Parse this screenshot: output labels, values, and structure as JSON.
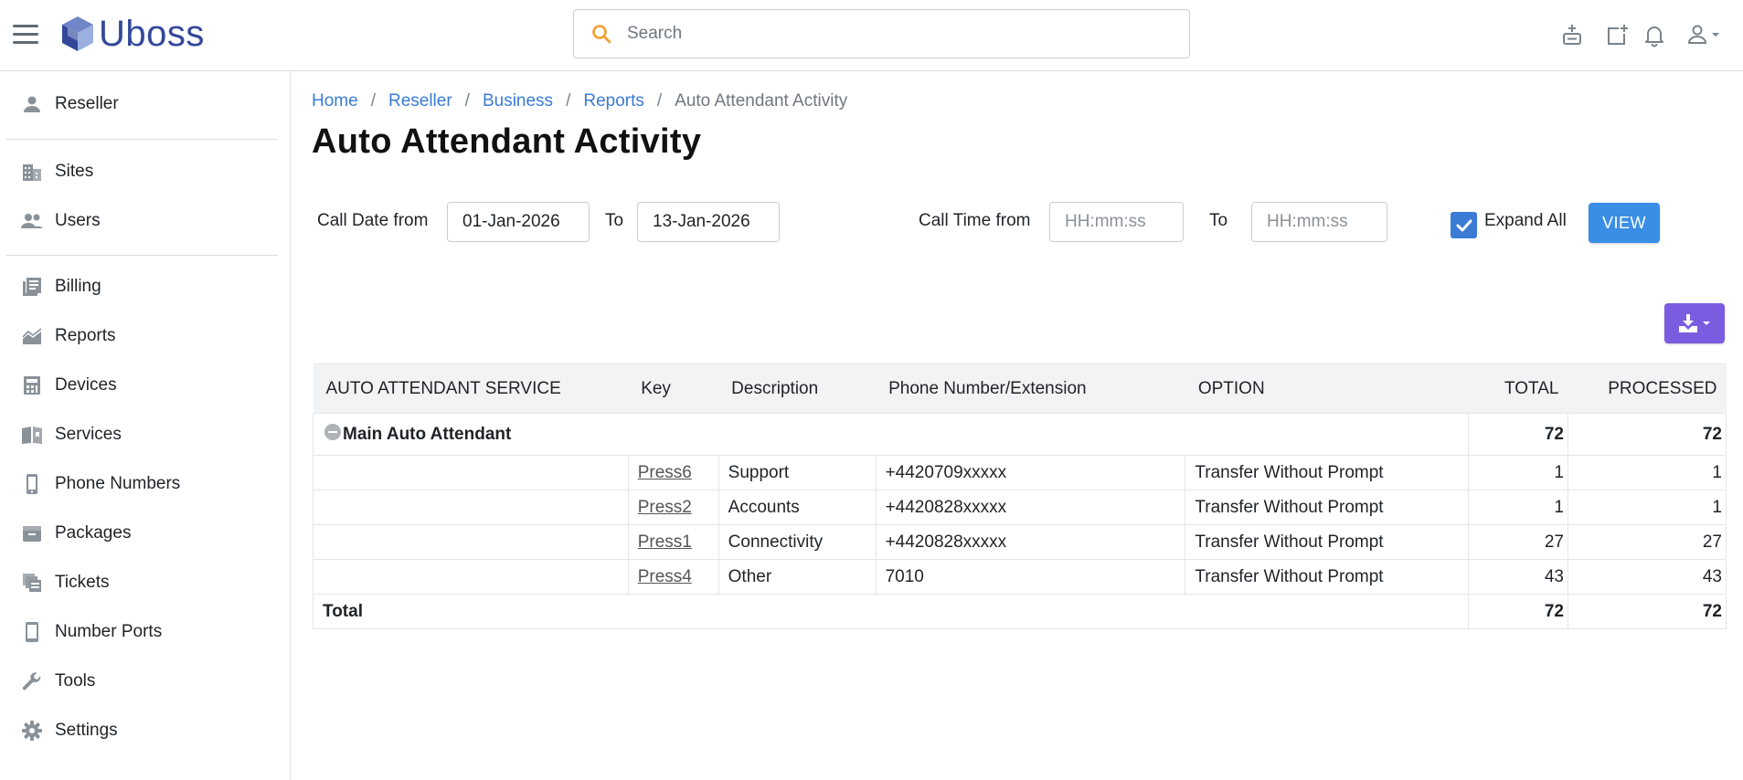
{
  "app": {
    "name": "Uboss"
  },
  "header": {
    "search_placeholder": "Search",
    "icons": [
      "add-contact-icon",
      "new-window-icon",
      "bell-icon",
      "user-icon"
    ]
  },
  "sidebar": {
    "items": [
      {
        "label": "Reseller",
        "icon": "person-icon"
      },
      {
        "label": "Sites",
        "icon": "building-icon"
      },
      {
        "label": "Users",
        "icon": "users-icon"
      },
      {
        "label": "Billing",
        "icon": "billing-icon"
      },
      {
        "label": "Reports",
        "icon": "chart-icon"
      },
      {
        "label": "Devices",
        "icon": "devices-icon"
      },
      {
        "label": "Services",
        "icon": "services-icon"
      },
      {
        "label": "Phone Numbers",
        "icon": "phone-icon"
      },
      {
        "label": "Packages",
        "icon": "package-icon"
      },
      {
        "label": "Tickets",
        "icon": "tickets-icon"
      },
      {
        "label": "Number Ports",
        "icon": "mobile-icon"
      },
      {
        "label": "Tools",
        "icon": "wrench-icon"
      },
      {
        "label": "Settings",
        "icon": "gear-icon"
      }
    ]
  },
  "breadcrumb": {
    "items": [
      "Home",
      "Reseller",
      "Business",
      "Reports"
    ],
    "current": "Auto Attendant Activity",
    "separator": "/"
  },
  "page": {
    "title": "Auto Attendant Activity"
  },
  "filters": {
    "call_date_from_label": "Call Date from",
    "call_date_from": "01-Jan-2026",
    "to_label": "To",
    "call_date_to": "13-Jan-2026",
    "call_time_from_label": "Call Time from",
    "call_time_from_placeholder": "HH:mm:ss",
    "call_time_to_label": "To",
    "call_time_to_placeholder": "HH:mm:ss",
    "expand_all_label": "Expand All",
    "expand_all_checked": true,
    "view_label": "VIEW"
  },
  "table": {
    "headers": [
      "AUTO ATTENDANT SERVICE",
      "Key",
      "Description",
      "Phone Number/Extension",
      "OPTION",
      "TOTAL",
      "PROCESSED"
    ],
    "group": {
      "name": "Main Auto Attendant",
      "total": "72",
      "processed": "72"
    },
    "rows": [
      {
        "key": "Press6",
        "description": "Support",
        "phone": "+4420709xxxxx",
        "option": "Transfer Without Prompt",
        "total": "1",
        "processed": "1"
      },
      {
        "key": "Press2",
        "description": "Accounts",
        "phone": "+4420828xxxxx",
        "option": "Transfer Without Prompt",
        "total": "1",
        "processed": "1"
      },
      {
        "key": "Press1",
        "description": "Connectivity",
        "phone": "+4420828xxxxx",
        "option": "Transfer Without Prompt",
        "total": "27",
        "processed": "27"
      },
      {
        "key": "Press4",
        "description": "Other",
        "phone": "7010",
        "option": "Transfer Without Prompt",
        "total": "43",
        "processed": "43"
      }
    ],
    "footer": {
      "label": "Total",
      "total": "72",
      "processed": "72"
    }
  },
  "colors": {
    "brand": "#33489a",
    "link": "#3a7bd5",
    "view_button": "#3a8ee6",
    "export_button": "#7b5ce0",
    "search_icon": "#f0a030"
  }
}
